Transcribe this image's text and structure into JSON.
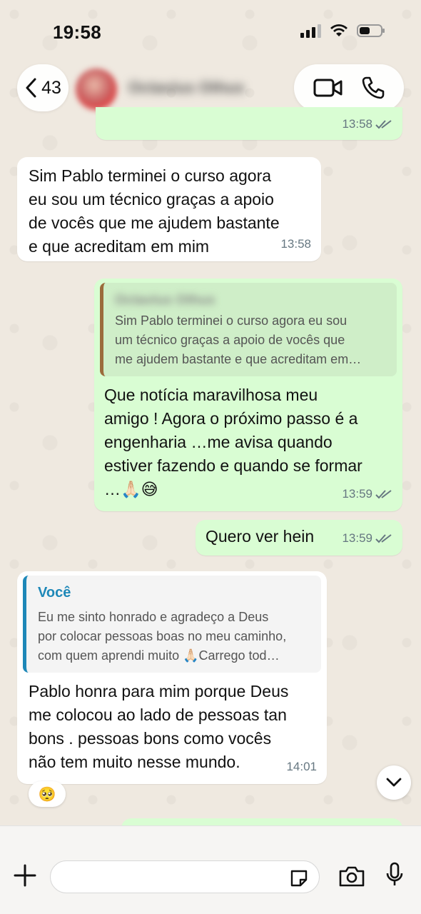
{
  "status_bar": {
    "time": "19:58"
  },
  "header": {
    "back_count": "43",
    "contact_name": "Octavius Othus"
  },
  "messages": [
    {
      "text": "",
      "time": "13:58"
    },
    {
      "text": "Sim Pablo terminei o curso agora\neu sou um técnico graças a apoio\nde vocês que me ajudem bastante\ne que acreditam em mim",
      "time": "13:58"
    },
    {
      "quote_author": "Octavius Othus",
      "quote_text": "Sim Pablo terminei o curso agora eu sou\num técnico graças a apoio de vocês que\nme ajudem bastante e que acreditam em…",
      "text": "Que notícia maravilhosa meu\namigo ! Agora o próximo passo é a\nengenharia …me avisa quando\nestiver fazendo e quando se formar\n…🙏🏻😅",
      "time": "13:59"
    },
    {
      "text": "Quero ver hein",
      "time": "13:59"
    },
    {
      "quote_author": "Você",
      "quote_text": "Eu me sinto honrado e agradeço a Deus\npor colocar pessoas boas no meu caminho,\ncom quem aprendi muito 🙏🏻Carrego tod…",
      "text": "Pablo honra para mim porque Deus\nme colocou ao lado de pessoas tan\nbons . pessoas bons como vocês\nnão tem muito nesse mundo.",
      "time": "14:01",
      "reaction": "🥺"
    }
  ],
  "colors": {
    "outgoing_bubble": "#d9fdd3",
    "incoming_bubble": "#ffffff",
    "read_ticks": "#667781",
    "quote_accent_out": "#9b6b3b",
    "quote_accent_in": "#1e88b8"
  },
  "icons": [
    "chevron-left-icon",
    "video-call-icon",
    "phone-icon",
    "chevron-down-icon",
    "plus-icon",
    "sticker-icon",
    "camera-icon",
    "mic-icon",
    "double-check-icon"
  ]
}
